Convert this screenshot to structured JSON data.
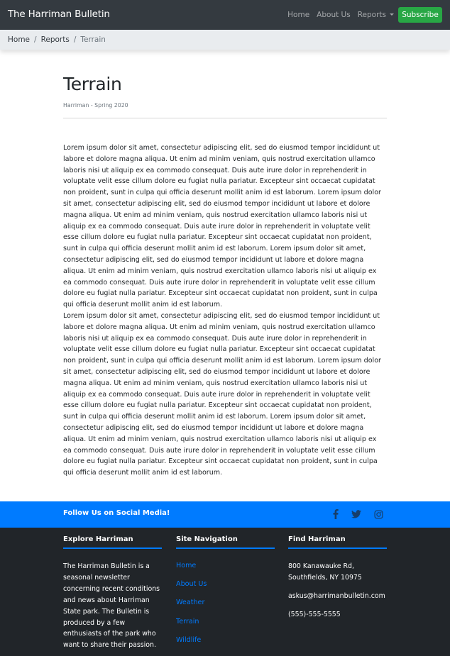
{
  "navbar": {
    "brand": "The Harriman Bulletin",
    "links": [
      {
        "label": "Home"
      },
      {
        "label": "About Us"
      },
      {
        "label": "Reports"
      }
    ],
    "subscribe_label": "Subscribe"
  },
  "breadcrumb": {
    "items": [
      "Home",
      "Reports"
    ],
    "separator": "/",
    "active": "Terrain"
  },
  "article": {
    "title": "Terrain",
    "subtitle": "Harriman - Spring 2020",
    "paragraphs": [
      "Lorem ipsum dolor sit amet, consectetur adipiscing elit, sed do eiusmod tempor incididunt ut labore et dolore magna aliqua. Ut enim ad minim veniam, quis nostrud exercitation ullamco laboris nisi ut aliquip ex ea commodo consequat. Duis aute irure dolor in reprehenderit in voluptate velit esse cillum dolore eu fugiat nulla pariatur. Excepteur sint occaecat cupidatat non proident, sunt in culpa qui officia deserunt mollit anim id est laborum. Lorem ipsum dolor sit amet, consectetur adipiscing elit, sed do eiusmod tempor incididunt ut labore et dolore magna aliqua. Ut enim ad minim veniam, quis nostrud exercitation ullamco laboris nisi ut aliquip ex ea commodo consequat. Duis aute irure dolor in reprehenderit in voluptate velit esse cillum dolore eu fugiat nulla pariatur. Excepteur sint occaecat cupidatat non proident, sunt in culpa qui officia deserunt mollit anim id est laborum. Lorem ipsum dolor sit amet, consectetur adipiscing elit, sed do eiusmod tempor incididunt ut labore et dolore magna aliqua. Ut enim ad minim veniam, quis nostrud exercitation ullamco laboris nisi ut aliquip ex ea commodo consequat. Duis aute irure dolor in reprehenderit in voluptate velit esse cillum dolore eu fugiat nulla pariatur. Excepteur sint occaecat cupidatat non proident, sunt in culpa qui officia deserunt mollit anim id est laborum.",
      "Lorem ipsum dolor sit amet, consectetur adipiscing elit, sed do eiusmod tempor incididunt ut labore et dolore magna aliqua. Ut enim ad minim veniam, quis nostrud exercitation ullamco laboris nisi ut aliquip ex ea commodo consequat. Duis aute irure dolor in reprehenderit in voluptate velit esse cillum dolore eu fugiat nulla pariatur. Excepteur sint occaecat cupidatat non proident, sunt in culpa qui officia deserunt mollit anim id est laborum. Lorem ipsum dolor sit amet, consectetur adipiscing elit, sed do eiusmod tempor incididunt ut labore et dolore magna aliqua. Ut enim ad minim veniam, quis nostrud exercitation ullamco laboris nisi ut aliquip ex ea commodo consequat. Duis aute irure dolor in reprehenderit in voluptate velit esse cillum dolore eu fugiat nulla pariatur. Excepteur sint occaecat cupidatat non proident, sunt in culpa qui officia deserunt mollit anim id est laborum. Lorem ipsum dolor sit amet, consectetur adipiscing elit, sed do eiusmod tempor incididunt ut labore et dolore magna aliqua. Ut enim ad minim veniam, quis nostrud exercitation ullamco laboris nisi ut aliquip ex ea commodo consequat. Duis aute irure dolor in reprehenderit in voluptate velit esse cillum dolore eu fugiat nulla pariatur. Excepteur sint occaecat cupidatat non proident, sunt in culpa qui officia deserunt mollit anim id est laborum."
    ]
  },
  "social": {
    "title": "Follow Us on Social Media!",
    "icons": [
      "facebook-icon",
      "twitter-icon",
      "instagram-icon"
    ]
  },
  "footer": {
    "explore": {
      "heading": "Explore Harriman",
      "text": "The Harriman Bulletin is a seasonal newsletter concerning recent conditions and news about Harriman State park. The Bulletin is produced by a few enthusiasts of the park who want to share their passion."
    },
    "site_nav": {
      "heading": "Site Navigation",
      "links": [
        "Home",
        "About Us",
        "Weather",
        "Terrain",
        "Wildlife"
      ]
    },
    "find": {
      "heading": "Find Harriman",
      "address_line1": "800 Kanawauke Rd,",
      "address_line2": "Southfields, NY 10975",
      "email": "askus@harrimanbulletin.com",
      "phone": "(555)-555-5555"
    }
  },
  "colors": {
    "navbar_bg": "#343a40",
    "subscribe_bg": "#28a745",
    "breadcrumb_bg": "#e9ecef",
    "social_bar_bg": "#007bff",
    "footer_bg": "#212529",
    "link": "#007bff"
  }
}
